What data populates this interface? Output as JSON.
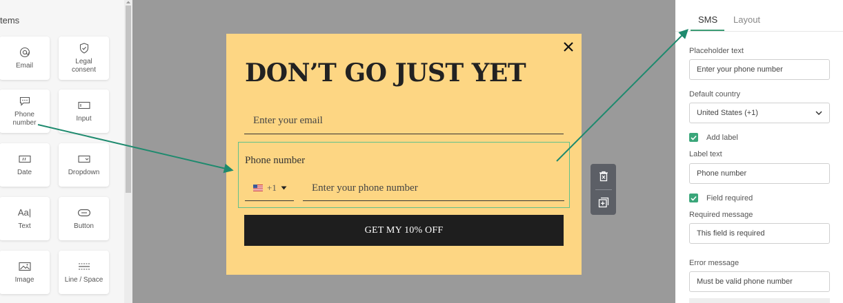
{
  "sidebar": {
    "title": "tems",
    "tiles": [
      {
        "label": "Email",
        "icon": "at-icon"
      },
      {
        "label": "Legal consent",
        "icon": "shield-check-icon"
      },
      {
        "label": "Phone number",
        "icon": "chat-bubble-icon"
      },
      {
        "label": "Input",
        "icon": "input-box-icon"
      },
      {
        "label": "Date",
        "icon": "calendar-icon"
      },
      {
        "label": "Dropdown",
        "icon": "dropdown-icon"
      },
      {
        "label": "Text",
        "icon": "text-icon"
      },
      {
        "label": "Button",
        "icon": "button-pill-icon"
      },
      {
        "label": "Image",
        "icon": "image-icon"
      },
      {
        "label": "Line / Space",
        "icon": "line-space-icon"
      }
    ],
    "text_icon_glyph": "Aa|"
  },
  "popup": {
    "headline": "DON’T GO JUST YET",
    "email_placeholder": "Enter your email",
    "phone_label": "Phone number",
    "country_code": "+1",
    "phone_placeholder": "Enter your phone number",
    "cta_label": "GET MY 10% OFF"
  },
  "panel": {
    "tabs": [
      {
        "label": "SMS",
        "active": true
      },
      {
        "label": "Layout",
        "active": false
      }
    ],
    "placeholder_text_label": "Placeholder text",
    "placeholder_text_value": "Enter your phone number",
    "default_country_label": "Default country",
    "default_country_value": "United States (+1)",
    "add_label_text": "Add label",
    "add_label_checked": true,
    "label_text_label": "Label text",
    "label_text_value": "Phone number",
    "field_required_text": "Field required",
    "field_required_checked": true,
    "required_message_label": "Required message",
    "required_message_value": "This field is required",
    "error_message_label": "Error message",
    "error_message_value": "Must be valid phone number"
  },
  "colors": {
    "popup_bg": "#fdd683",
    "canvas_bg": "#9a9a9a",
    "accent_green": "#3aa67a",
    "arrow_green": "#1e8a6e",
    "cta_bg": "#1e1e1e"
  }
}
